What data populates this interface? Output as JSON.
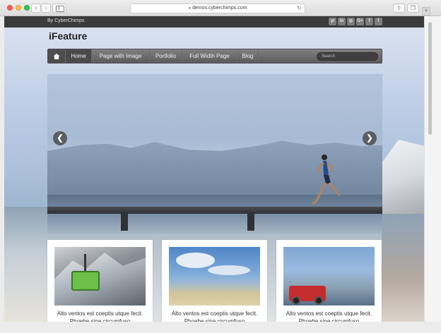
{
  "browser": {
    "url": "demos.cyberchimps.com"
  },
  "site": {
    "tagline": "By CyberChimps",
    "title": "iFeature",
    "social": [
      "yt",
      "in",
      "◎",
      "G+",
      "f",
      "t"
    ]
  },
  "nav": {
    "items": [
      "Home",
      "Page with Image",
      "Portfolio",
      "Full Width Page",
      "Blog"
    ],
    "search_placeholder": "Search"
  },
  "slider": {
    "prev": "❮",
    "next": "❯"
  },
  "cards": [
    {
      "text": "Alto ventos est coeptis utque fecit. Phoebe sine circumfuso"
    },
    {
      "text": "Alto ventos est coeptis utque fecit. Phoebe sine circumfuso"
    },
    {
      "text": "Alto ventos est coeptis utque fecit. Phoebe sine circumfuso"
    }
  ],
  "colors": {
    "topbar": "#3b3b3b",
    "navbar": "#6e6e6e",
    "nav_active": "#4a4a4a"
  }
}
